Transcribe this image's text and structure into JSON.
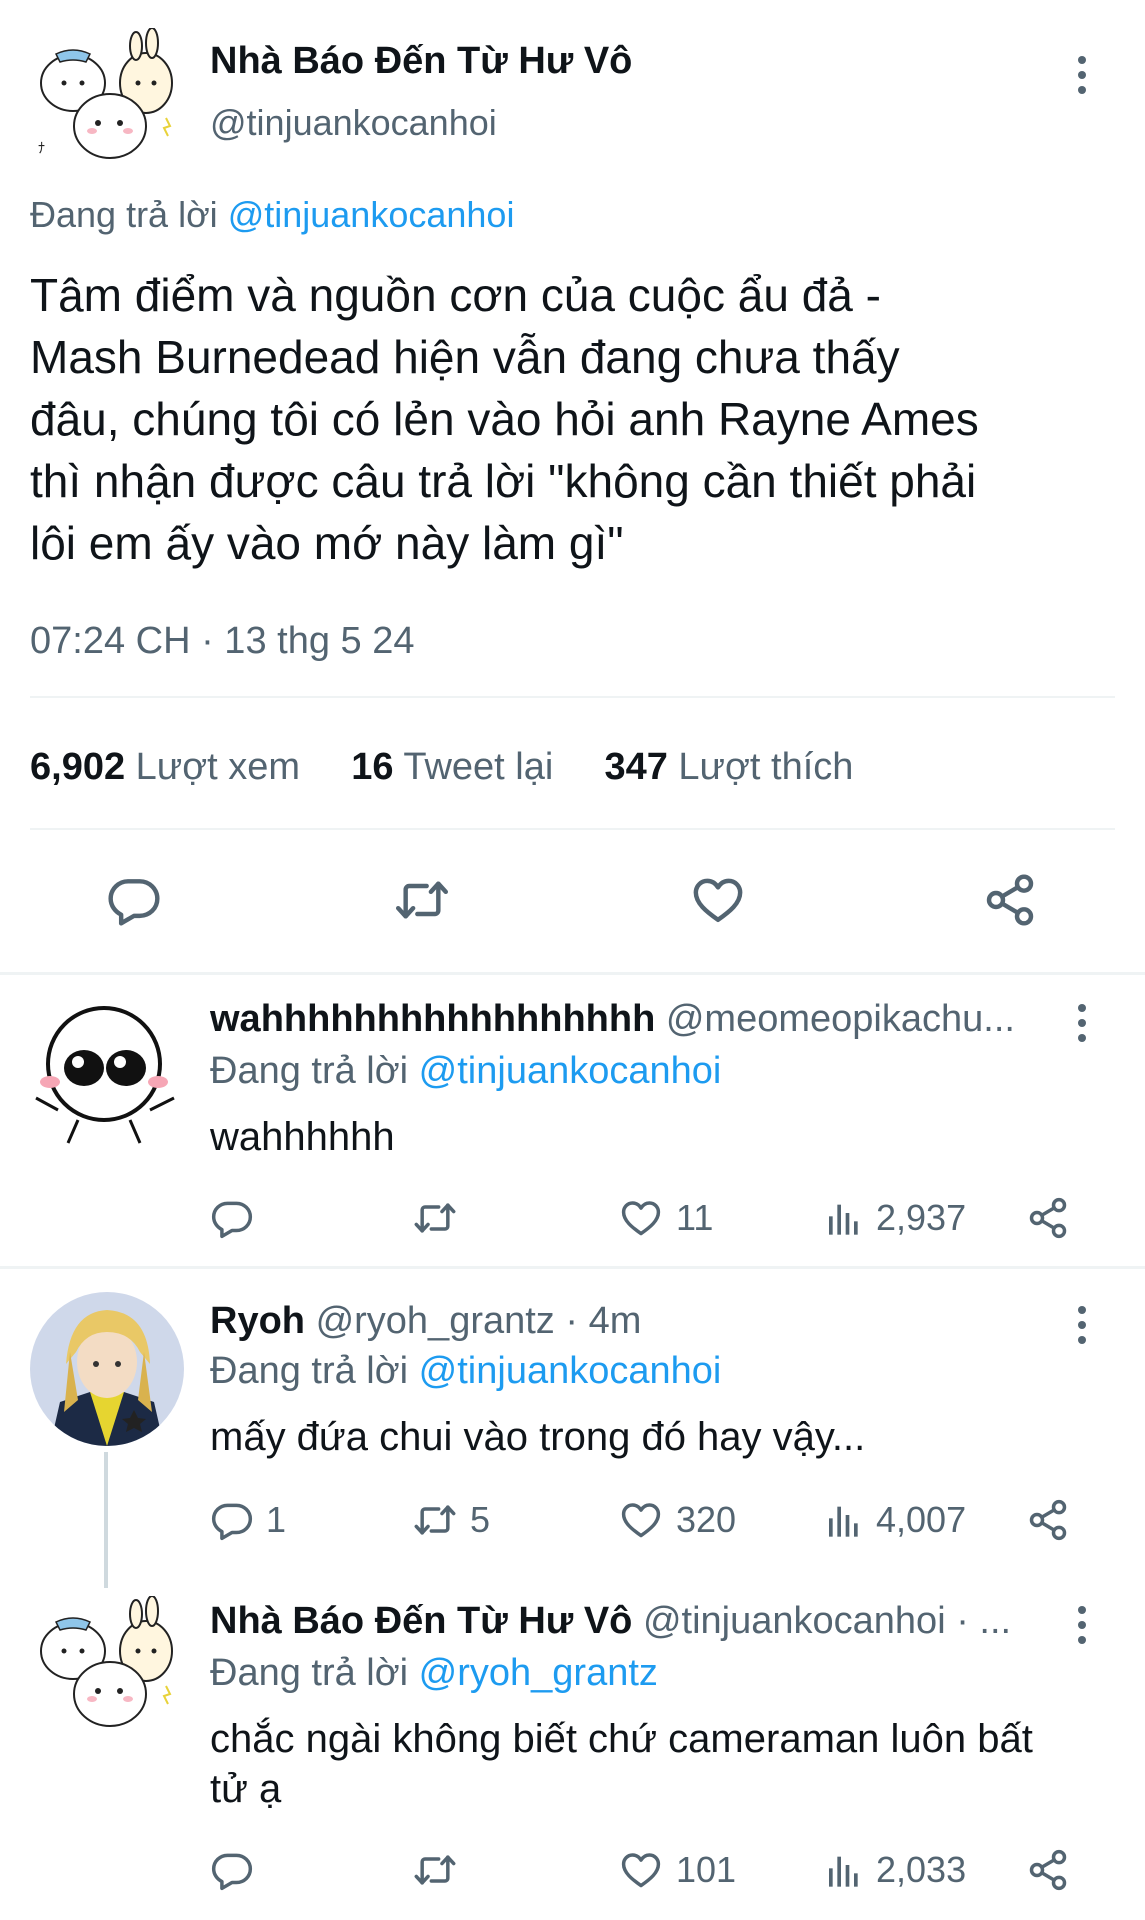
{
  "main_tweet": {
    "author_name": "Nhà Báo Đến Từ Hư Vô",
    "handle": "@tinjuankocanhoi",
    "replying_prefix": "Đang trả lời",
    "replying_to": "@tinjuankocanhoi",
    "text_lines": [
      "Tâm điểm và nguồn cơn của cuộc ẩu đả -",
      "Mash Burnedead hiện vẫn đang chưa thấy",
      "đâu, chúng tôi có lẻn vào hỏi anh Rayne Ames",
      "thì nhận được câu trả lời \"không cần thiết phải",
      "lôi em ấy vào mớ này làm gì\""
    ],
    "timestamp": "07:24 CH · 13 thg 5 24",
    "stats": {
      "views_count": "6,902",
      "views_label": "Lượt xem",
      "retweets_count": "16",
      "retweets_label": "Tweet lại",
      "likes_count": "347",
      "likes_label": "Lượt thích"
    }
  },
  "replies": [
    {
      "author_name": "wahhhhhhhhhhhhhhhhh",
      "handle_meta": "@meomeopikachu...",
      "replying_prefix": "Đang trả lời",
      "replying_to": "@tinjuankocanhoi",
      "text": "wahhhhhh",
      "reply_count": "",
      "retweet_count": "",
      "like_count": "11",
      "view_count": "2,937"
    },
    {
      "author_name": "Ryoh",
      "handle_meta": "@ryoh_grantz · 4m",
      "replying_prefix": "Đang trả lời",
      "replying_to": "@tinjuankocanhoi",
      "text": "mấy đứa chui vào trong đó hay vậy...",
      "reply_count": "1",
      "retweet_count": "5",
      "like_count": "320",
      "view_count": "4,007"
    },
    {
      "author_name": "Nhà Báo Đến Từ Hư Vô",
      "handle_meta": "@tinjuankocanhoi · ...",
      "replying_prefix": "Đang trả lời",
      "replying_to": "@ryoh_grantz",
      "text_line1": "chắc ngài không biết chứ cameraman luôn bất",
      "text_line2": "tử ạ",
      "reply_count": "",
      "retweet_count": "",
      "like_count": "101",
      "view_count": "2,033"
    }
  ],
  "icons": {
    "reply": "reply-icon",
    "retweet": "retweet-icon",
    "like": "heart-icon",
    "views": "views-icon",
    "share": "share-icon",
    "more": "more-icon"
  },
  "colors": {
    "link_blue": "#1d9bf0",
    "secondary_text": "#536471",
    "divider": "#eff3f4"
  }
}
